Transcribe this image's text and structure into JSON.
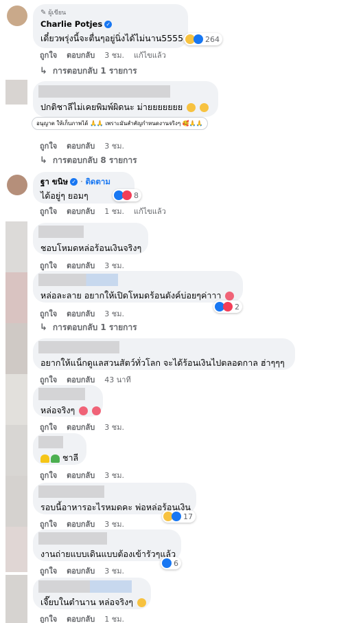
{
  "comments": [
    {
      "badge": "ผู้เขียน",
      "name": "Charlie Potjes",
      "text": "เดี๋ยวพรุ่งนี้จะตื่นๆอยู่นิ่งได้ไม่นาน5555",
      "reaction_count": "264",
      "actions": [
        "ถูกใจ",
        "ตอบกลับ",
        "3 ชม.",
        "แก้ไขแล้ว"
      ],
      "replies": "การตอบกลับ 1 รายการ"
    },
    {
      "text": "ปกติชาลีไม่เคยพิมพ์ผิดนะ ม่ายยยยยยย",
      "note": "อนุญาต ให้เก็บภาพได้ 🙏🙏 เพราะมันสำคัญกำหนดงานจริงๆ 🥰🙏🙏",
      "actions": [
        "ถูกใจ",
        "ตอบกลับ",
        "3 ชม."
      ],
      "replies": "การตอบกลับ 8 รายการ"
    },
    {
      "name": "ฐา ขนิษ",
      "follow": "ติดตาม",
      "text": "ได้อยู่ๆ ยอมๆ",
      "reaction_count": "8",
      "actions": [
        "ถูกใจ",
        "ตอบกลับ",
        "1 ชม.",
        "แก้ไขแล้ว"
      ]
    },
    {
      "text": "ชอบโหมดหล่อร้อนเงินจริงๆ",
      "actions": [
        "ถูกใจ",
        "ตอบกลับ",
        "3 ชม."
      ]
    },
    {
      "text": "หล่อละลาย อยากให้เปิดโหมดร้อนดังค์บ่อยๆค่าาา",
      "reaction_count": "2",
      "actions": [
        "ถูกใจ",
        "ตอบกลับ",
        "3 ชม."
      ],
      "replies": "การตอบกลับ 1 รายการ"
    },
    {
      "text": "อยากให้แน็กดูแลสวนสัตว์ทั่วโลก จะได้ร้อนเงินไปตลอดกาล ฮ่าๆๆๆ",
      "actions": [
        "ถูกใจ",
        "ตอบกลับ",
        "43 นาที"
      ]
    },
    {
      "text": "หล่อจริงๆ",
      "actions": [
        "ถูกใจ",
        "ตอบกลับ",
        "3 ชม."
      ]
    },
    {
      "text": "ชาลี",
      "actions": [
        "ถูกใจ",
        "ตอบกลับ",
        "3 ชม."
      ]
    },
    {
      "text": "รอบนี้อาหารอะไรหมดคะ พ่อหล่อร้อนเงิน",
      "reaction_count": "17",
      "actions": [
        "ถูกใจ",
        "ตอบกลับ",
        "3 ชม."
      ]
    },
    {
      "text": "งานถ่ายแบบเดินแบบต้องเข้ารัวๆแล้ว",
      "reaction_count": "6",
      "actions": [
        "ถูกใจ",
        "ตอบกลับ",
        "3 ชม."
      ]
    },
    {
      "text": "เจี๊ยบในตำนาน หล่อจริงๆ",
      "actions": [
        "ถูกใจ",
        "ตอบกลับ",
        "1 ชม."
      ]
    }
  ],
  "colors": {
    "bubble": "#f0f2f5",
    "meta": "#65676b",
    "link": "#1877f2"
  }
}
